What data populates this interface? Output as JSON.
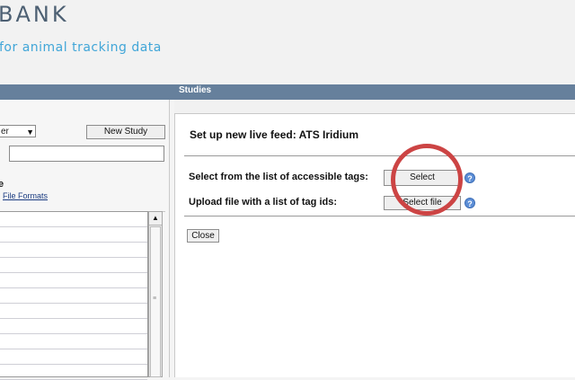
{
  "header": {
    "logo_text": "BANK",
    "tagline": "for animal tracking data"
  },
  "left_panel": {
    "select_fragment": "er",
    "new_study_label": "New Study",
    "search_value": "",
    "heading_fragment": "e",
    "file_formats_link": "File Formats",
    "list_rows": [
      "",
      "",
      "",
      "",
      "",
      "",
      "",
      "",
      "",
      "",
      ""
    ]
  },
  "studies": {
    "title": "Studies"
  },
  "live_feed": {
    "title": "Set up new live feed: ATS Iridium",
    "select_label": "Select from the list of accessible tags:",
    "select_button": "Select",
    "upload_label": "Upload file with a list of tag ids:",
    "select_file_button": "Select file",
    "close_button": "Close"
  },
  "colors": {
    "bar": "#66809c",
    "logo": "#4d6073",
    "tagline": "#41a6d8",
    "highlight": "#cc4444",
    "help": "#5c8ed6"
  }
}
